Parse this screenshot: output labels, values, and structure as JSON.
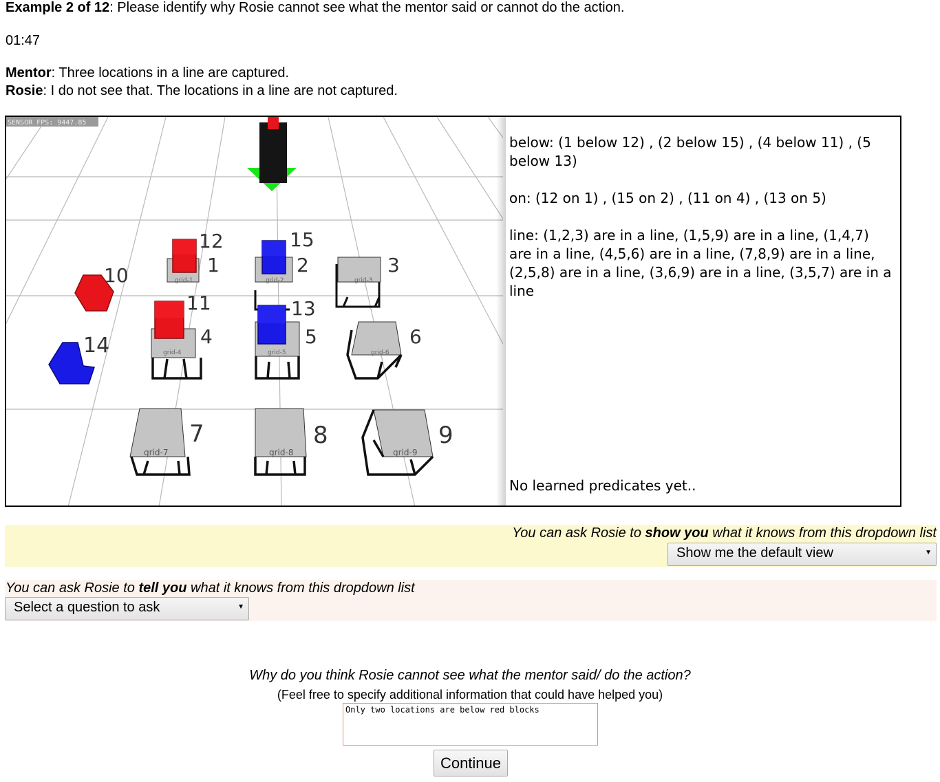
{
  "header": {
    "example_label": "Example 2 of 12",
    "instruction": ": Please identify why Rosie cannot see what the mentor said or cannot do the action.",
    "timer": "01:47"
  },
  "dialog": {
    "mentor_name": "Mentor",
    "mentor_text": ": Three locations in a line are captured.",
    "rosie_name": "Rosie",
    "rosie_text": ": I do not see that. The locations in a line are not captured."
  },
  "scene": {
    "fps_label": "SENSOR FPS: 9447.85",
    "locations": [
      {
        "id": "1",
        "grid": "grid-1"
      },
      {
        "id": "2",
        "grid": "grid-2"
      },
      {
        "id": "3",
        "grid": "grid-3"
      },
      {
        "id": "4",
        "grid": "grid-4"
      },
      {
        "id": "5",
        "grid": "grid-5"
      },
      {
        "id": "6",
        "grid": "grid-6"
      },
      {
        "id": "7",
        "grid": "grid-7"
      },
      {
        "id": "8",
        "grid": "grid-8"
      },
      {
        "id": "9",
        "grid": "grid-9"
      }
    ],
    "blocks": [
      {
        "id": "10",
        "color": "#e8141b"
      },
      {
        "id": "11",
        "color": "#e8141b"
      },
      {
        "id": "12",
        "color": "#e8141b"
      },
      {
        "id": "13",
        "color": "#1a1ae6"
      },
      {
        "id": "14",
        "color": "#1a1ae6"
      },
      {
        "id": "15",
        "color": "#1a1ae6"
      }
    ]
  },
  "knowledge": {
    "below": "below: (1 below 12) , (2 below 15) , (4 below 11) , (5 below 13)",
    "on": "on: (12 on 1) , (15 on 2) , (11 on 4) , (13 on 5)",
    "line": "line: (1,2,3) are in a line, (1,5,9) are in a line, (1,4,7) are in a line, (4,5,6) are in a line, (7,8,9) are in a line, (2,5,8) are in a line, (3,6,9) are in a line, (3,5,7) are in a line",
    "learned": "No learned predicates yet.."
  },
  "show_panel": {
    "prompt_before": "You can ask Rosie to ",
    "prompt_bold": "show you",
    "prompt_after": " what it knows from this dropdown list",
    "selected": "Show me the default view"
  },
  "tell_panel": {
    "prompt_before": "You can ask Rosie to ",
    "prompt_bold": "tell you",
    "prompt_after": " what it knows from this dropdown list",
    "selected": "Select a question to ask"
  },
  "question": {
    "why": "Why do you think Rosie cannot see what the mentor said/ do the action?",
    "hint": "(Feel free to specify additional information that could have helped you)",
    "answer": "Only two locations are below red blocks"
  },
  "continue_label": "Continue"
}
